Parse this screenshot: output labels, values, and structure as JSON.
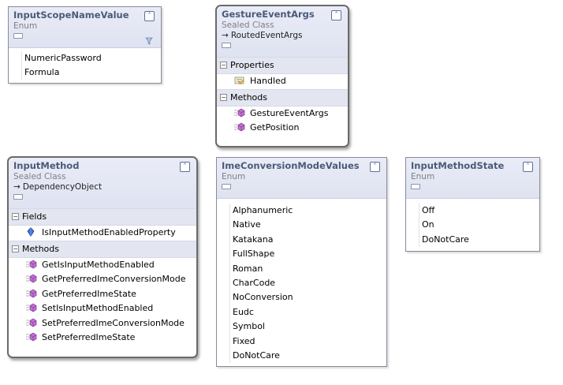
{
  "shapes": {
    "input_scope_name_value": {
      "title": "InputScopeNameValue",
      "stereotype": "Enum",
      "values": [
        "NumericPassword",
        "Formula"
      ]
    },
    "gesture_event_args": {
      "title": "GestureEventArgs",
      "stereotype": "Sealed Class",
      "base": "RoutedEventArgs",
      "properties_label": "Properties",
      "properties": [
        "Handled"
      ],
      "methods_label": "Methods",
      "methods": [
        "GestureEventArgs",
        "GetPosition"
      ]
    },
    "input_method": {
      "title": "InputMethod",
      "stereotype": "Sealed Class",
      "base": "DependencyObject",
      "fields_label": "Fields",
      "fields": [
        "IsInputMethodEnabledProperty"
      ],
      "methods_label": "Methods",
      "methods": [
        "GetIsInputMethodEnabled",
        "GetPreferredImeConversionMode",
        "GetPreferredImeState",
        "SetIsInputMethodEnabled",
        "SetPreferredImeConversionMode",
        "SetPreferredImeState"
      ]
    },
    "ime_conversion_mode_values": {
      "title": "ImeConversionModeValues",
      "stereotype": "Enum",
      "values": [
        "Alphanumeric",
        "Native",
        "Katakana",
        "FullShape",
        "Roman",
        "CharCode",
        "NoConversion",
        "Eudc",
        "Symbol",
        "Fixed",
        "DoNotCare"
      ]
    },
    "input_method_state": {
      "title": "InputMethodState",
      "stereotype": "Enum",
      "values": [
        "Off",
        "On",
        "DoNotCare"
      ]
    }
  },
  "icons": {
    "collapse": "double-chevron-up-icon",
    "inherits": "arrow-right-icon",
    "property": "property-hand-icon",
    "method": "method-purple-cube-icon",
    "field": "field-blue-diamond-icon",
    "filter": "filter-funnel-icon"
  },
  "colors": {
    "header_gradient_top": "#e9ecf7",
    "header_gradient_bottom": "#dfe3f1",
    "title_text": "#4a5a78",
    "section_header": "#e3e6f0",
    "method_icon": "#b25cc4",
    "field_icon": "#2f62c9"
  }
}
